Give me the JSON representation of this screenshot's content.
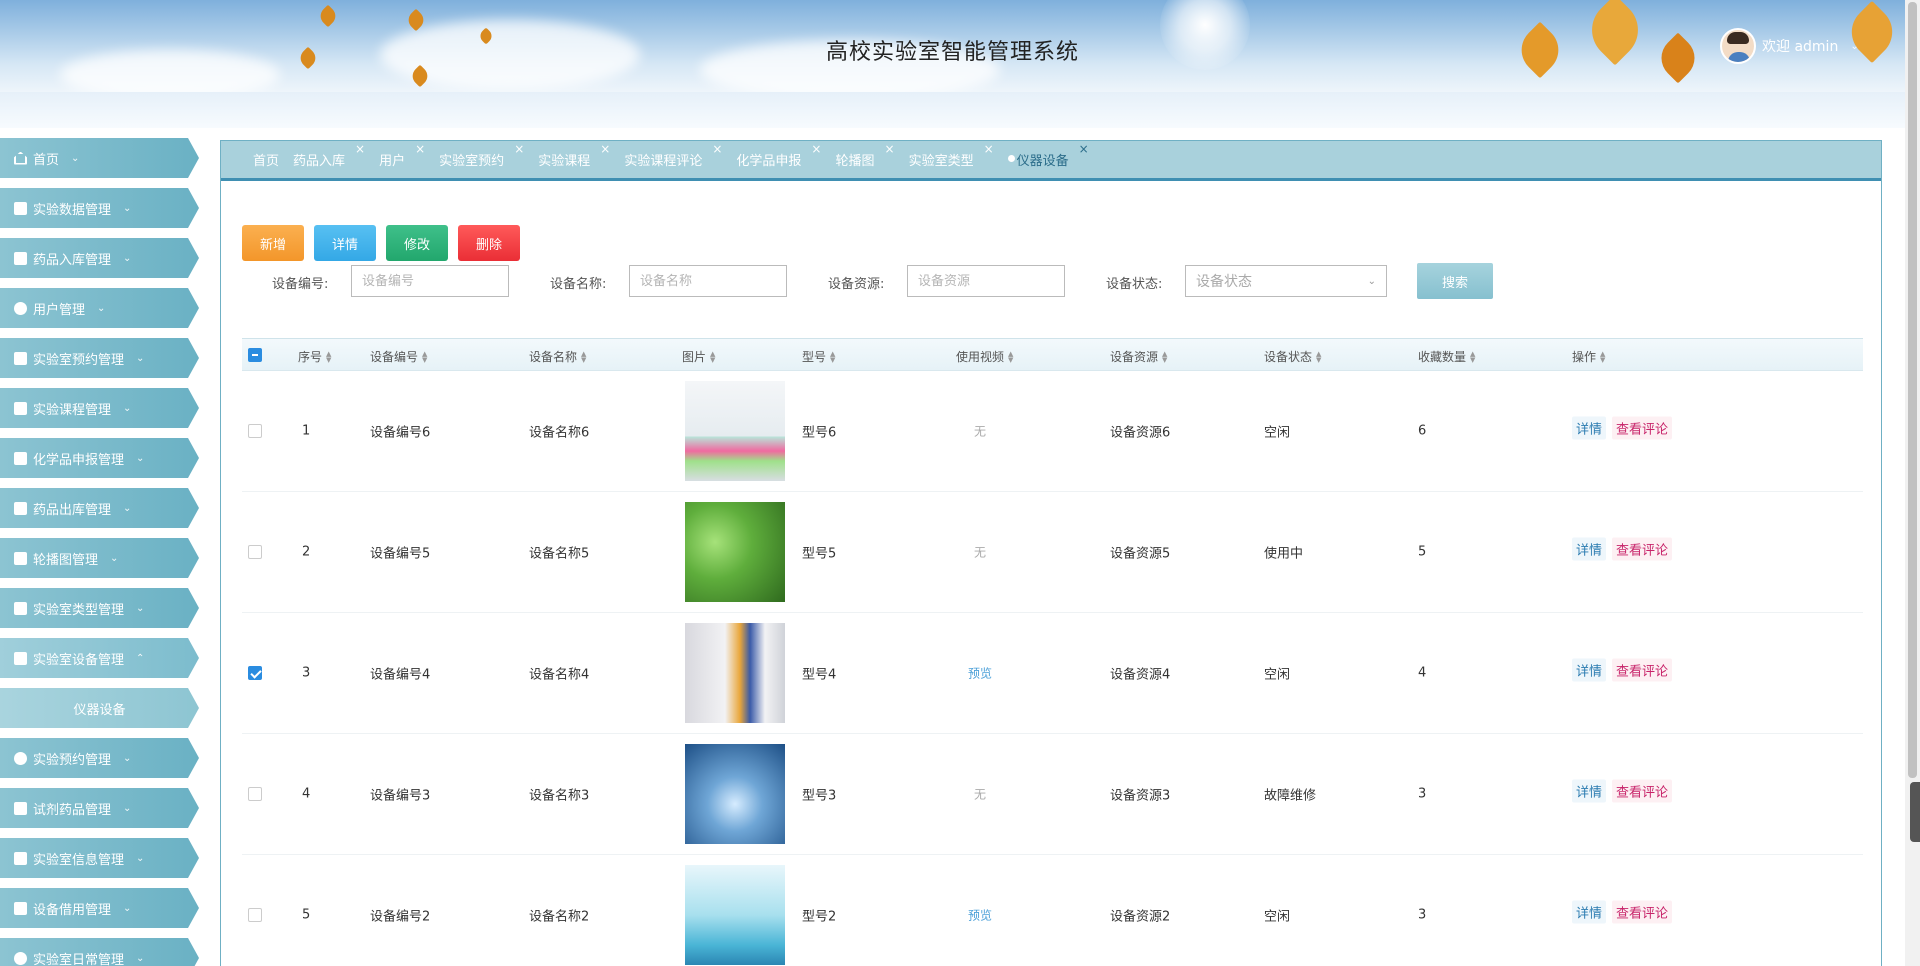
{
  "header": {
    "title": "高校实验室智能管理系统",
    "welcome": "欢迎 admin"
  },
  "sidebar": {
    "items": [
      {
        "label": "首页",
        "icon": "home-icon"
      },
      {
        "label": "实验数据管理",
        "icon": "document-icon"
      },
      {
        "label": "药品入库管理",
        "icon": "image-icon"
      },
      {
        "label": "用户管理",
        "icon": "user-icon"
      },
      {
        "label": "实验室预约管理",
        "icon": "grid-icon"
      },
      {
        "label": "实验课程管理",
        "icon": "list-icon"
      },
      {
        "label": "化学品申报管理",
        "icon": "table-icon"
      },
      {
        "label": "药品出库管理",
        "icon": "box-icon"
      },
      {
        "label": "轮播图管理",
        "icon": "briefcase-icon"
      },
      {
        "label": "实验室类型管理",
        "icon": "book-icon"
      },
      {
        "label": "实验室设备管理",
        "icon": "device-icon",
        "open": true
      },
      {
        "label": "仪器设备",
        "sub": true
      },
      {
        "label": "实验预约管理",
        "icon": "clock-icon"
      },
      {
        "label": "试剂药品管理",
        "icon": "gift-icon"
      },
      {
        "label": "实验室信息管理",
        "icon": "info-icon"
      },
      {
        "label": "设备借用管理",
        "icon": "crop-icon"
      },
      {
        "label": "实验室日常管理",
        "icon": "drop-icon"
      }
    ]
  },
  "tabs": [
    {
      "label": "首页",
      "closable": false
    },
    {
      "label": "药品入库",
      "closable": true
    },
    {
      "label": "用户",
      "closable": true
    },
    {
      "label": "实验室预约",
      "closable": true
    },
    {
      "label": "实验课程",
      "closable": true
    },
    {
      "label": "实验课程评论",
      "closable": true
    },
    {
      "label": "化学品申报",
      "closable": true
    },
    {
      "label": "轮播图",
      "closable": true
    },
    {
      "label": "实验室类型",
      "closable": true
    },
    {
      "label": "仪器设备",
      "closable": true,
      "active": true
    }
  ],
  "toolbar": {
    "add": "新增",
    "detail": "详情",
    "edit": "修改",
    "delete": "删除"
  },
  "filters": {
    "code_label": "设备编号:",
    "code_placeholder": "设备编号",
    "name_label": "设备名称:",
    "name_placeholder": "设备名称",
    "resource_label": "设备资源:",
    "resource_placeholder": "设备资源",
    "status_label": "设备状态:",
    "status_placeholder": "设备状态",
    "search": "搜索"
  },
  "table": {
    "headers": [
      "序号",
      "设备编号",
      "设备名称",
      "图片",
      "型号",
      "使用视频",
      "设备资源",
      "设备状态",
      "收藏数量",
      "操作"
    ],
    "rows": [
      {
        "index": "1",
        "code": "设备编号6",
        "name": "设备名称6",
        "model": "型号6",
        "video": "无",
        "video_link": false,
        "resource": "设备资源6",
        "status": "空闲",
        "favorites": "6",
        "checked": false
      },
      {
        "index": "2",
        "code": "设备编号5",
        "name": "设备名称5",
        "model": "型号5",
        "video": "无",
        "video_link": false,
        "resource": "设备资源5",
        "status": "使用中",
        "favorites": "5",
        "checked": false
      },
      {
        "index": "3",
        "code": "设备编号4",
        "name": "设备名称4",
        "model": "型号4",
        "video": "预览",
        "video_link": true,
        "resource": "设备资源4",
        "status": "空闲",
        "favorites": "4",
        "checked": true
      },
      {
        "index": "4",
        "code": "设备编号3",
        "name": "设备名称3",
        "model": "型号3",
        "video": "无",
        "video_link": false,
        "resource": "设备资源3",
        "status": "故障维修",
        "favorites": "3",
        "checked": false
      },
      {
        "index": "5",
        "code": "设备编号2",
        "name": "设备名称2",
        "model": "型号2",
        "video": "预览",
        "video_link": true,
        "resource": "设备资源2",
        "status": "空闲",
        "favorites": "3",
        "checked": false
      }
    ],
    "op_detail": "详情",
    "op_comment": "查看评论"
  },
  "colors": {
    "accent": "#6ab1c4",
    "tab_border": "#3f8fb2",
    "link": "#2a7bb0",
    "comment": "#c8246a"
  }
}
